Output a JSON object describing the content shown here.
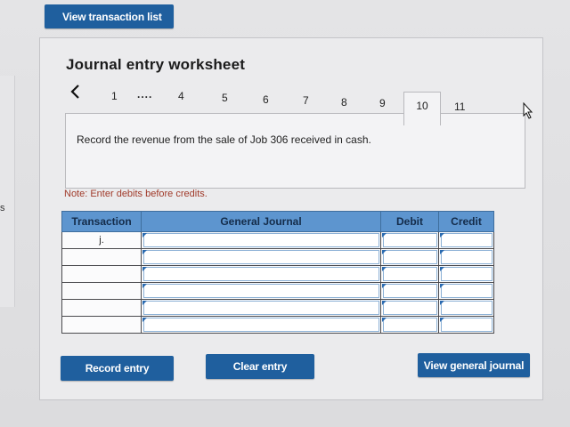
{
  "top_button": "View transaction list",
  "title": "Journal entry worksheet",
  "nav": {
    "prev_icon": "chevron-left-icon",
    "pages": [
      "1",
      "....",
      "4",
      "5",
      "6",
      "7",
      "8",
      "9",
      "10",
      "11"
    ],
    "active_page": "10"
  },
  "instruction": "Record the revenue from the sale of Job 306 received in cash.",
  "note": "Note: Enter debits before credits.",
  "side_text": "s",
  "table": {
    "headers": [
      "Transaction",
      "General Journal",
      "Debit",
      "Credit"
    ],
    "rows": [
      {
        "transaction": "j.",
        "account": "",
        "debit": "",
        "credit": ""
      },
      {
        "transaction": "",
        "account": "",
        "debit": "",
        "credit": ""
      },
      {
        "transaction": "",
        "account": "",
        "debit": "",
        "credit": ""
      },
      {
        "transaction": "",
        "account": "",
        "debit": "",
        "credit": ""
      },
      {
        "transaction": "",
        "account": "",
        "debit": "",
        "credit": ""
      },
      {
        "transaction": "",
        "account": "",
        "debit": "",
        "credit": ""
      }
    ]
  },
  "buttons": {
    "record": "Record entry",
    "clear": "Clear entry",
    "view_general_journal": "View general journal"
  },
  "colors": {
    "button_blue": "#1f5f9e",
    "header_blue": "#5d95cf",
    "note_red": "#a03a2a"
  }
}
